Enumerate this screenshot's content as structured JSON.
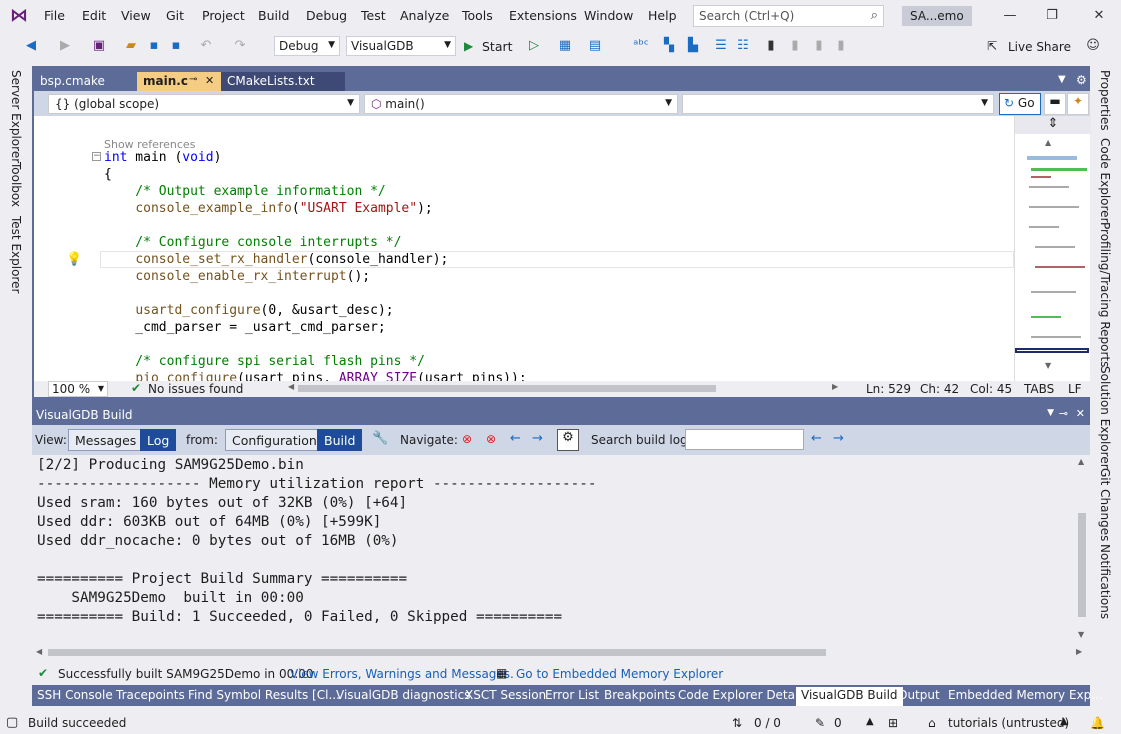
{
  "menu": [
    "File",
    "Edit",
    "View",
    "Git",
    "Project",
    "Build",
    "Debug",
    "Test",
    "Analyze",
    "Tools",
    "Extensions",
    "Window",
    "Help"
  ],
  "search": {
    "placeholder": "Search (Ctrl+Q)"
  },
  "solution_name": "SA...emo",
  "toolbar": {
    "config": "Debug",
    "platform": "VisualGDB",
    "start_label": "Start",
    "live_share": "Live Share"
  },
  "left_tools": [
    "Server Explorer",
    "Toolbox",
    "Test Explorer"
  ],
  "right_tools": [
    "Properties",
    "Code Explorer",
    "Profiling/Tracing Reports",
    "Solution Explorer",
    "Git Changes",
    "Notifications"
  ],
  "editor_tabs": [
    {
      "label": "bsp.cmake"
    },
    {
      "label": "main.c",
      "active": true
    },
    {
      "label": "CMakeLists.txt"
    }
  ],
  "nav": {
    "scope": "{} (global scope)",
    "member": "main()",
    "go": "Go"
  },
  "code": {
    "show_refs": "Show references",
    "lines": [
      "int main (void)",
      "{",
      "    /* Output example information */",
      "    console_example_info(\"USART Example\");",
      "",
      "    /* Configure console interrupts */",
      "    console_set_rx_handler(console_handler);",
      "    console_enable_rx_interrupt();",
      "",
      "    usartd_configure(0, &usart_desc);",
      "    _cmd_parser = _usart_cmd_parser;",
      "",
      "    /* configure spi serial flash pins */",
      "    pio_configure(usart_pins, ARRAY_SIZE(usart_pins));"
    ]
  },
  "editor_status": {
    "zoom": "100 %",
    "issues": "No issues found",
    "ln": "Ln: 529",
    "ch": "Ch: 42",
    "col": "Col: 45",
    "tabs": "TABS",
    "eol": "LF"
  },
  "build_panel": {
    "title": "VisualGDB Build",
    "view_label": "View:",
    "view_opts": [
      "Messages",
      "Log"
    ],
    "from_label": "from:",
    "from_opts": [
      "Configuration",
      "Build"
    ],
    "navigate_label": "Navigate:",
    "search_label": "Search build log:",
    "log": [
      "[2/2] Producing SAM9G25Demo.bin",
      "------------------- Memory utilization report -------------------",
      "Used sram: 160 bytes out of 32KB (0%) [+64]",
      "Used ddr: 603KB out of 64MB (0%) [+599K]",
      "Used ddr_nocache: 0 bytes out of 16MB (0%)",
      "",
      "========== Project Build Summary ==========",
      "    SAM9G25Demo  built in 00:00",
      "========== Build: 1 Succeeded, 0 Failed, 0 Skipped =========="
    ],
    "status": "Successfully built SAM9G25Demo in 00:00.",
    "link1": "View Errors, Warnings and Messages.",
    "link2": "Go to Embedded Memory Explorer"
  },
  "bottom_tabs": [
    "SSH Console",
    "Tracepoints",
    "Find Symbol Results [Cl...",
    "VisualGDB diagnostics",
    "XSCT Session",
    "Error List",
    "Breakpoints",
    "Code Explorer Details",
    "VisualGDB Build",
    "Output",
    "Embedded Memory Exp..."
  ],
  "statusbar": {
    "left": "Build succeeded",
    "changes": "0 / 0",
    "edits": "0",
    "branch": "tutorials (untrusted)"
  }
}
